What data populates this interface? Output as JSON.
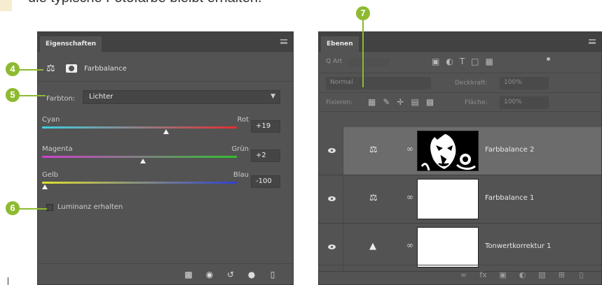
{
  "caption": {
    "text": "die typische Fotofarbe bleibt erhalten."
  },
  "callouts": [
    "4",
    "5",
    "6",
    "7"
  ],
  "colors": {
    "callout": "#8dba30",
    "panel_bg": "#535353",
    "selected_row": "#6c6c6c"
  },
  "properties_panel": {
    "tab": "Eigenschaften",
    "header_title": "Farbbalance",
    "tone_label": "Farbton:",
    "tone_value": "Lichter",
    "sliders": [
      {
        "left": "Cyan",
        "right": "Rot",
        "value": "+19",
        "position": 0.64,
        "gradient": [
          "#40d0e0",
          "#e03030"
        ]
      },
      {
        "left": "Magenta",
        "right": "Grün",
        "value": "+2",
        "position": 0.52,
        "gradient": [
          "#d040d0",
          "#30c030"
        ]
      },
      {
        "left": "Gelb",
        "right": "Blau",
        "value": "-100",
        "position": 0.0,
        "gradient": [
          "#e0e030",
          "#3040d0"
        ]
      }
    ],
    "luminance_label": "Luminanz erhalten",
    "luminance_checked": false,
    "bottom_icons": [
      "clip-icon",
      "view-previous-icon",
      "reset-icon",
      "visibility-icon",
      "trash-icon"
    ]
  },
  "layers_panel": {
    "tab": "Ebenen",
    "filter": {
      "kind_label": "Q Art"
    },
    "blend": {
      "mode": "Normal",
      "opacity_label": "Deckkraft:",
      "opacity_value": "100%"
    },
    "lock": {
      "label": "Fixieren:",
      "fill_label": "Fläche:",
      "fill_value": "100%"
    },
    "layers": [
      {
        "name": "Farbbalance 2",
        "type": "color-balance",
        "thumb": "photo",
        "selected": true
      },
      {
        "name": "Farbbalance 1",
        "type": "color-balance",
        "thumb": "white",
        "selected": false
      },
      {
        "name": "Tonwertkorrektur 1",
        "type": "levels",
        "thumb": "white",
        "selected": false
      }
    ]
  }
}
